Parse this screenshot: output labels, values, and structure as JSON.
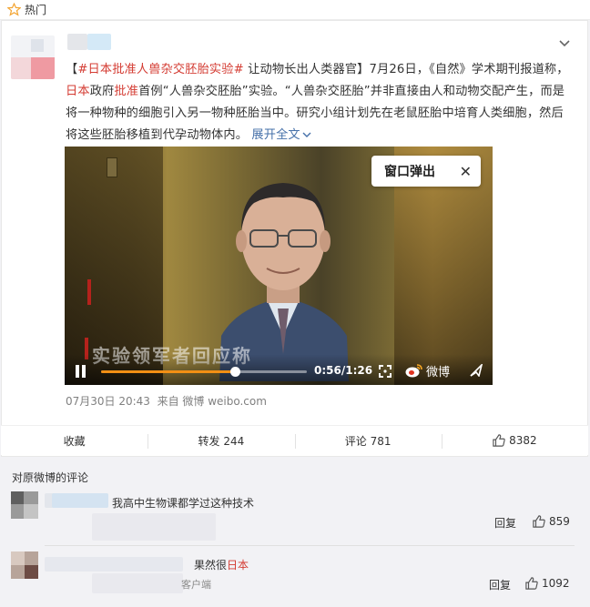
{
  "topbar": {
    "label": "热门",
    "icon": "star-icon"
  },
  "post": {
    "hashtag_open": "【",
    "hashtag": "#日本批准人兽杂交胚胎实验#",
    "headline_rest": " 让动物长出人类器官】7月26日，《自然》学术期刊报道称，",
    "line2_red1": "日本",
    "line2_mid": "政府",
    "line2_red2": "批准",
    "line2_rest": "首例“人兽杂交胚胎”实验。“人兽杂交胚胎”并非直接由人和动物交配产生，而是将一种物种的细胞引入另一物种胚胎当中。研究小组计划先在老鼠胚胎中培育人类细胞，然后将这些胚胎移植到代孕动物体内。",
    "expand_label": "展开全文",
    "timestamp": "07月30日 20:43",
    "source": "来自 微博 weibo.com"
  },
  "video": {
    "popup_label": "窗口弹出",
    "popup_close": "✕",
    "caption": "实验领军者回应称",
    "time": "0:56/1:26",
    "progress": 0.651,
    "brand": "微博"
  },
  "actions": {
    "favorite": "收藏",
    "repost": "转发 244",
    "comment": "评论 781",
    "like": "8382"
  },
  "comments": {
    "title": "对原微博的评论",
    "items": [
      {
        "text": "我高中生物课都学过这种技术",
        "reply": "回复",
        "likes": "859"
      },
      {
        "text_prefix": "果然很",
        "text_red": "日本",
        "client": "客户端",
        "reply": "回复",
        "likes": "1092"
      }
    ]
  },
  "colors": {
    "accent_red": "#d43c33",
    "link_blue": "#4570a9",
    "progress_orange": "#f28f14"
  }
}
